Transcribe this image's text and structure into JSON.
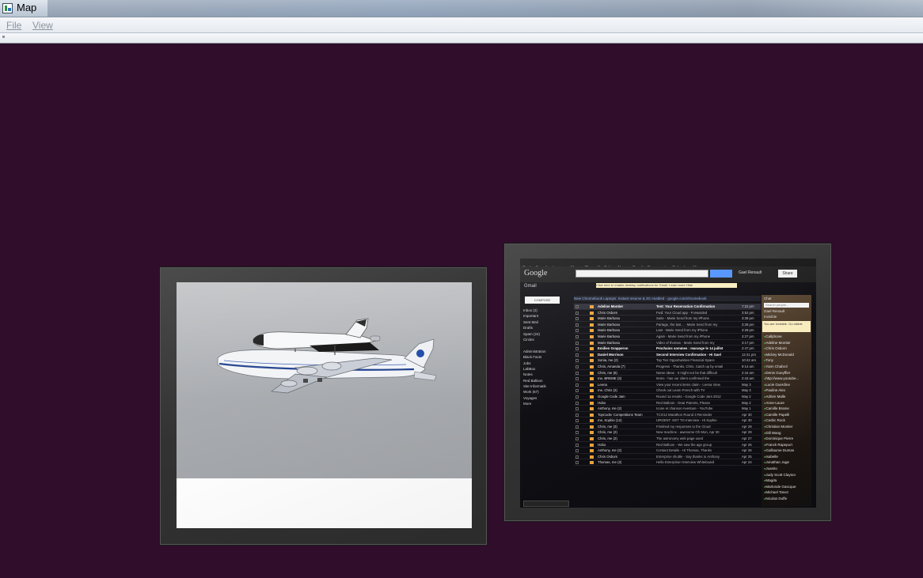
{
  "window": {
    "title": "Map"
  },
  "menu": {
    "file": "File",
    "view": "View"
  },
  "gmail": {
    "topbar": [
      "+Gael",
      "Search",
      "Images",
      "Maps",
      "Play",
      "YouTube",
      "News",
      "Gmail",
      "Documents",
      "Calendar",
      "More"
    ],
    "logo": "Google",
    "user": "Gael Renault",
    "share": "Share",
    "label": "Gmail",
    "notice": "Click here to enable desktop notifications for Gmail.   Learn more   Hide",
    "compose": "COMPOSE",
    "banner": "New Chromebook Laptops: Instant resume & 3G enabled - google.com/chromebook",
    "folders": [
      "Inbox (2)",
      "Important",
      "Sent Mail",
      "Drafts",
      "Spam (24)",
      "Circles",
      "",
      "Administration",
      "Black Facts",
      "Jobs",
      "LabBox",
      "Notes",
      "Red Balloon",
      "Site Informatik",
      "Work (67)",
      "Voyages",
      "More"
    ],
    "rows": [
      {
        "from": "Adeline Montier",
        "subj": "Test: Your Reservation Confirmation",
        "date": "7:22 pm",
        "unread": true
      },
      {
        "from": "Chris Osborn",
        "subj": "Fwd: Your Cloud app - Forwarded",
        "date": "3:52 pm"
      },
      {
        "from": "Marie Barbosa",
        "subj": "Suite - Marie Send from my iPhone",
        "date": "3:39 pm"
      },
      {
        "from": "Marie Barbosa",
        "subj": "Partage, the last... - Marie Send from my",
        "date": "3:28 pm"
      },
      {
        "from": "Marie Barbosa",
        "subj": "Last - Marie Send from my iPhone",
        "date": "3:28 pm"
      },
      {
        "from": "Marie Barbosa",
        "subj": "Again - Marie Send from my iPhone",
        "date": "3:27 pm"
      },
      {
        "from": "Marie Barbosa",
        "subj": "Video of thomas - Marie Send from my",
        "date": "3:17 pm"
      },
      {
        "from": "Emilien Grapperon",
        "subj": "Prochains sommes : marange le 14 juillet",
        "date": "2:47 pm",
        "unread": true
      },
      {
        "from": "Daniel Morrison",
        "subj": "Second Interview Confirmation - Hi Gael",
        "date": "12:41 pm",
        "unread": true
      },
      {
        "from": "Sonia, me (2)",
        "subj": "Top Tier Opportunities Financial Space",
        "date": "10:42 am"
      },
      {
        "from": "Chris, Amanda (7)",
        "subj": "Progress - Thanks, Chris. Catch up by email",
        "date": "9:14 am"
      },
      {
        "from": "Chris, me (6)",
        "subj": "Name ideas - It might not be that difficult",
        "date": "2:44 am"
      },
      {
        "from": "me, BREME (3)",
        "subj": "Items - has our client confirmed the",
        "date": "2:43 am"
      },
      {
        "from": "Leena",
        "subj": "View your recent items claim - Leena View",
        "date": "May 3"
      },
      {
        "from": "me, Chris (2)",
        "subj": "Check out Learn French with TV",
        "date": "May 3"
      },
      {
        "from": "Google Code Jam",
        "subj": "Round 1a results - Google Code Jam 2012",
        "date": "May 2"
      },
      {
        "from": "Hobo",
        "subj": "Red Balloon - Dear Parents, Please",
        "date": "May 2"
      },
      {
        "from": "Anthony, me (2)",
        "subj": "Icone et chanson Aventure - YouTube",
        "date": "May 1"
      },
      {
        "from": "TopCoder Competitions Team",
        "subj": "TCO12 Marathon Round 3 Reminder",
        "date": "Apr 30"
      },
      {
        "from": "me, Sophie (12)",
        "subj": "URGENT: GET TO Interview - Hi Sophie",
        "date": "Apr 30"
      },
      {
        "from": "Chris, me (3)",
        "subj": "Finished my responses to the Cloud",
        "date": "Apr 29"
      },
      {
        "from": "Chris, me (2)",
        "subj": "New machine - awesome Oh Mon, Apr 30",
        "date": "Apr 29"
      },
      {
        "from": "Chris, me (2)",
        "subj": "The astronomy web page used",
        "date": "Apr 27"
      },
      {
        "from": "Hobo",
        "subj": "Red Balloon - We saw the age group",
        "date": "Apr 26"
      },
      {
        "from": "Anthony, me (2)",
        "subj": "Contact Details - Hi Thomas, Thanks",
        "date": "Apr 26"
      },
      {
        "from": "Chris Osborn",
        "subj": "Enterprise shuttle - Say thanks to Anthony",
        "date": "Apr 25"
      },
      {
        "from": "Thomas, me (2)",
        "subj": "Hello Enterprise! Interview Whiteboard",
        "date": "Apr 24"
      }
    ],
    "chat": {
      "header": "Chat",
      "search": "Search people...",
      "me": "Gael Renault",
      "status": "Invisible",
      "note": "You are invisible. Go visible",
      "contacts": [
        "Callphone",
        "Adeline Montier",
        "Chris Osborn",
        "Mickey McDonald",
        "Tony",
        "Yann Chabrol",
        "Denis Gueyffier",
        "http://www.youtube...",
        "Lucie Guerdine",
        "Pauline Alex",
        "Adrien Malle",
        "Anne-Laure",
        "Camille Brame",
        "Camille Papelli",
        "Cedric Rock",
        "Christian Montier",
        "Dill Wang",
        "Dominique Pierre",
        "Franck Rapeport",
        "Guillaume Dumas",
        "Isabelle",
        "Jonathan Juge",
        "Juanito",
        "Judy Scott Clayton",
        "Magda",
        "Marlonde Gascque",
        "Michael Tanez",
        "Nicolas Duffe"
      ]
    }
  }
}
